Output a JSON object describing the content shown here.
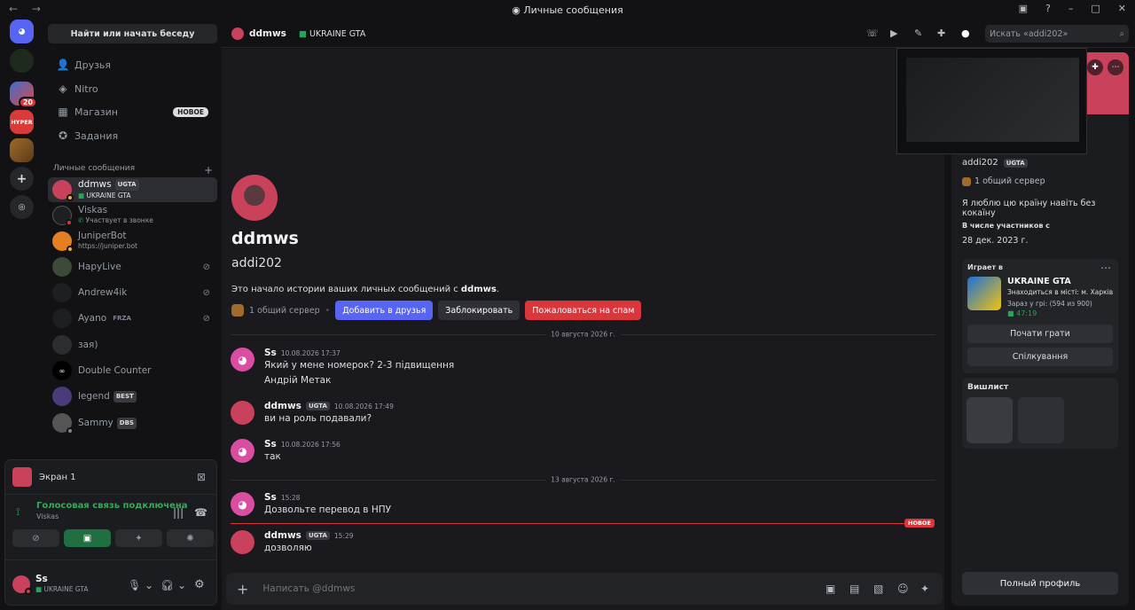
{
  "window": {
    "title": "Личные сообщения"
  },
  "servers": {
    "badge": "20",
    "hyper_label": "HYPER"
  },
  "sidebar": {
    "search_label": "Найти или начать беседу",
    "nav": [
      {
        "label": "Друзья"
      },
      {
        "label": "Nitro"
      },
      {
        "label": "Магазин",
        "badge": "НОВОЕ"
      },
      {
        "label": "Задания"
      }
    ],
    "dm_header": "Личные сообщения",
    "dms": [
      {
        "name": "ddmws",
        "tag": "UGTA",
        "sub": "UKRAINE GTA"
      },
      {
        "name": "Viskas",
        "sub": "Участвует в звонке"
      },
      {
        "name": "JuniperBot",
        "sub": "https://juniper.bot"
      },
      {
        "name": "HapyLive"
      },
      {
        "name": "Andrew4ik"
      },
      {
        "name": "Ayano",
        "tag": "FRZA"
      },
      {
        "name": "зая)"
      },
      {
        "name": "Double Counter"
      },
      {
        "name": "legend",
        "tag": "BEST"
      },
      {
        "name": "Sammy",
        "tag": "DBS"
      }
    ]
  },
  "voice": {
    "screen_label": "Экран 1",
    "connected": "Голосовая связь подключена",
    "channel": "Viskas"
  },
  "user": {
    "name": "Ss",
    "status": "UKRAINE GTA"
  },
  "header": {
    "name": "ddmws",
    "game": "UKRAINE GTA",
    "search_placeholder": "Искать «addi202»"
  },
  "intro": {
    "name": "ddmws",
    "username": "addi202",
    "text_prefix": "Это начало истории ваших личных сообщений с ",
    "text_name": "ddmws",
    "mutual": "1 общий сервер",
    "add_friend": "Добавить в друзья",
    "block": "Заблокировать",
    "report": "Пожаловаться на спам"
  },
  "dates": [
    "10 августа 2026 г.",
    "13 августа 2026 г."
  ],
  "new_label": "НОВОЕ",
  "messages": [
    {
      "author": "Ss",
      "time": "10.08.2026 17:37",
      "lines": [
        "Який у мене номерок? 2-3 підвищення",
        "Андрій Метак"
      ]
    },
    {
      "author": "ddmws",
      "tag": "UGTA",
      "time": "10.08.2026 17:49",
      "lines": [
        "ви на роль подавали?"
      ]
    },
    {
      "author": "Ss",
      "time": "10.08.2026 17:56",
      "lines": [
        "так"
      ]
    },
    {
      "author": "Ss",
      "time": "15:28",
      "lines": [
        "Дозвольте перевод в НПУ"
      ]
    },
    {
      "author": "ddmws",
      "tag": "UGTA",
      "time": "15:29",
      "lines": [
        "дозволяю"
      ]
    }
  ],
  "composer": {
    "placeholder": "Написать @ddmws"
  },
  "profile": {
    "username": "addi202",
    "tag": "UGTA",
    "mutual": "1 общий сервер",
    "bio": "Я люблю цю країну навіть без кокаїну",
    "member_since_label": "В числе участников с",
    "member_since": "28 дек. 2023 г.",
    "playing_label": "Играет в",
    "game_name": "UKRAINE GTA",
    "game_detail": "Знаходиться в місті: м. Харків",
    "game_players": "Зараз у грі: (594 из 900)",
    "game_time": "47:19",
    "play_btn": "Почати грати",
    "chat_btn": "Спілкування",
    "wishlist_label": "Вишлист",
    "full_profile": "Полный профиль"
  },
  "colors": {
    "blurple": "#5865f2",
    "red": "#da373c",
    "green": "#23a55a",
    "bg": "#1a1a1e"
  }
}
